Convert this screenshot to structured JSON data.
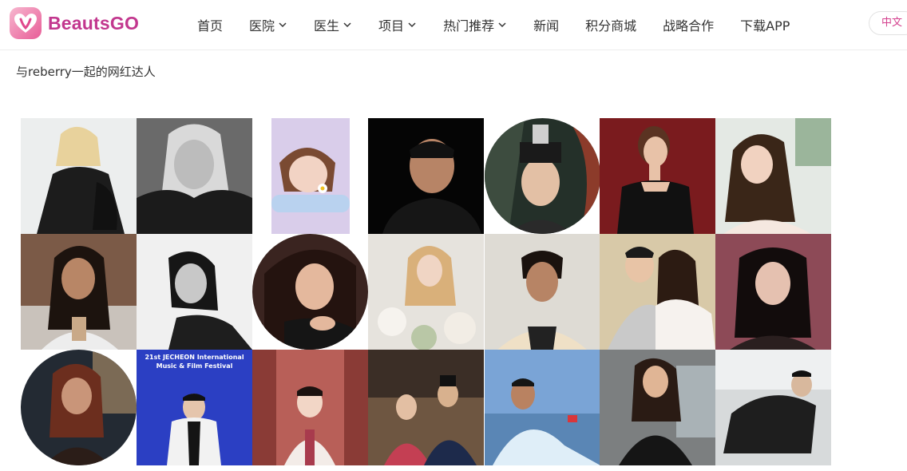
{
  "brand": {
    "name": "BeautsGO",
    "accent": "#c2378e",
    "logo_icon": "heart-logo-icon"
  },
  "nav": {
    "items": [
      {
        "label": "首页",
        "dropdown": false
      },
      {
        "label": "医院",
        "dropdown": true
      },
      {
        "label": "医生",
        "dropdown": true
      },
      {
        "label": "项目",
        "dropdown": true
      },
      {
        "label": "热门推荐",
        "dropdown": true
      },
      {
        "label": "新闻",
        "dropdown": false
      },
      {
        "label": "积分商城",
        "dropdown": false
      },
      {
        "label": "战略合作",
        "dropdown": false
      },
      {
        "label": "下载APP",
        "dropdown": false
      }
    ],
    "language": "中文"
  },
  "page": {
    "heading": "与reberry一起的网红达人"
  },
  "gallery_texts": {
    "festival_line1": "21st JECHEON International",
    "festival_line2": "Music & Film Festival"
  }
}
